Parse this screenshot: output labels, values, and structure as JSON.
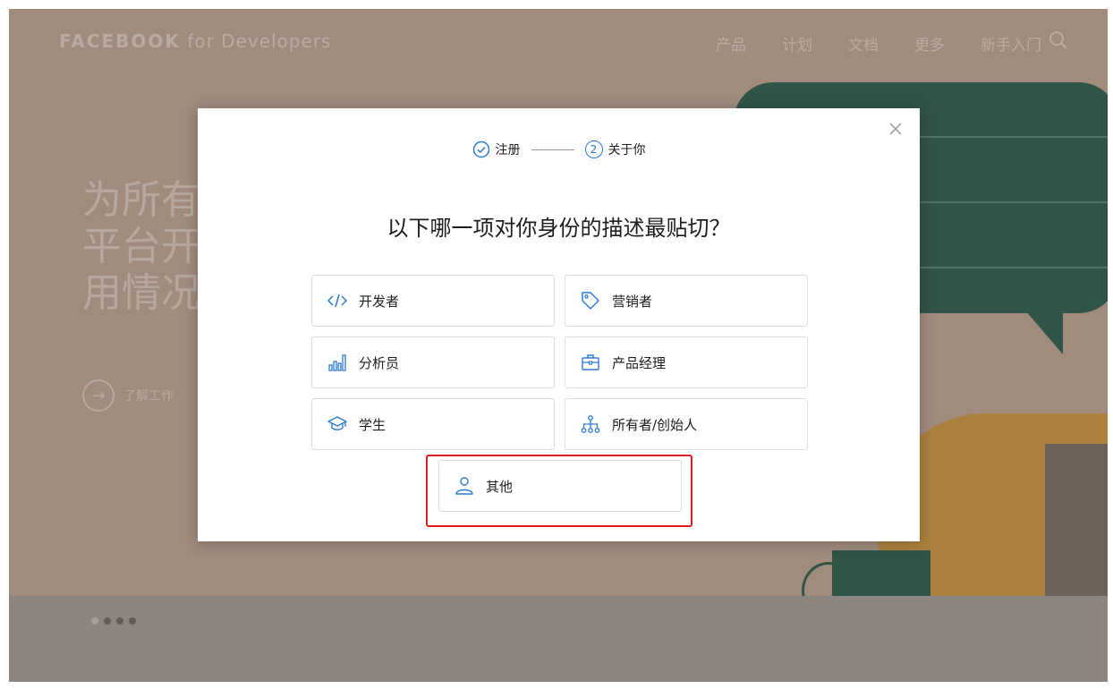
{
  "nav": {
    "logo_bold": "FACEBOOK",
    "logo_rest": " for Developers",
    "links": [
      "产品",
      "计划",
      "文档",
      "更多",
      "新手入门"
    ]
  },
  "hero": {
    "line1": "为所有",
    "line2": "平台开",
    "line3": "用情况",
    "cta": "了解工作"
  },
  "modal": {
    "steps": [
      {
        "label": "注册",
        "state": "done"
      },
      {
        "label": "关于你",
        "number": "2",
        "state": "current"
      }
    ],
    "title": "以下哪一项对你身份的描述最贴切？",
    "options": [
      {
        "label": "开发者",
        "icon": "code-icon"
      },
      {
        "label": "营销者",
        "icon": "tag-icon"
      },
      {
        "label": "分析员",
        "icon": "bar-chart-icon"
      },
      {
        "label": "产品经理",
        "icon": "briefcase-icon"
      },
      {
        "label": "学生",
        "icon": "graduation-cap-icon"
      },
      {
        "label": "所有者/创始人",
        "icon": "org-chart-icon"
      }
    ],
    "other": {
      "label": "其他",
      "icon": "person-icon"
    }
  },
  "colors": {
    "accent": "#2d7bd6",
    "highlight": "#e02020",
    "hero_bg": "#c7b1a4",
    "bubble": "#1d5d52",
    "mustard": "#d7a242"
  }
}
